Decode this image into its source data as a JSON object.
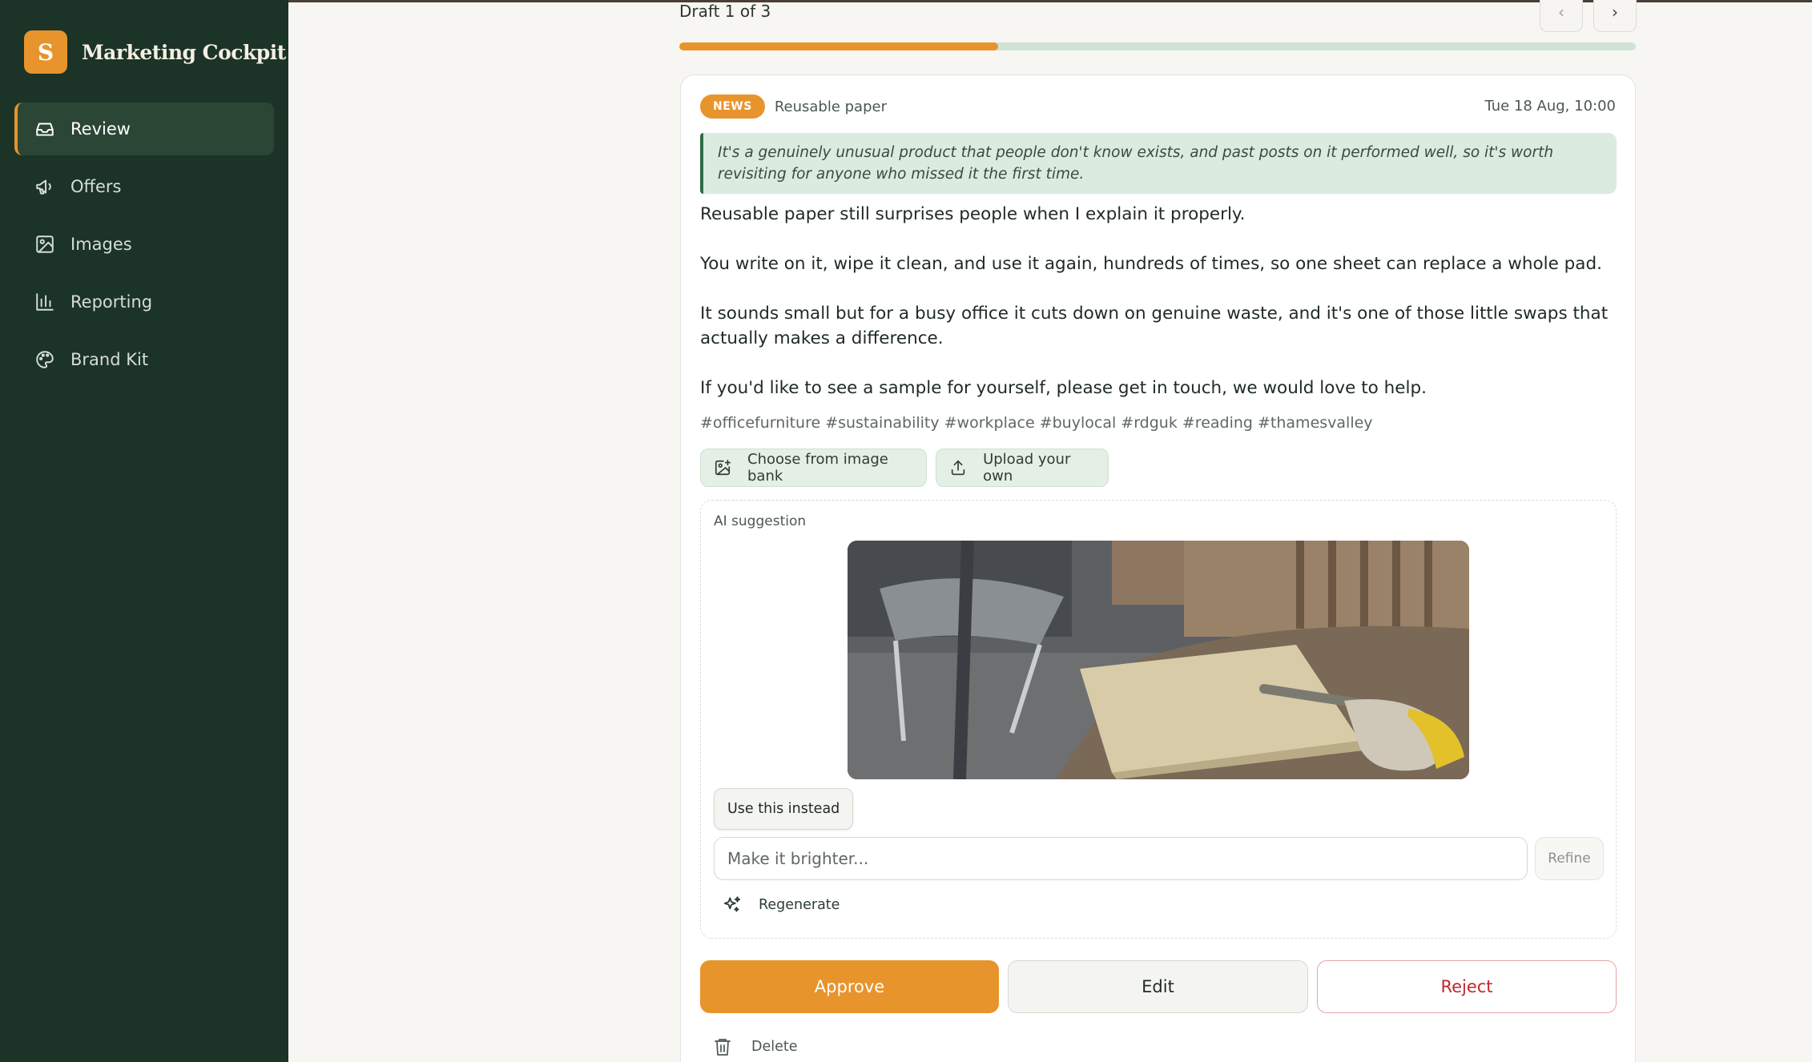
{
  "app": {
    "logo_letter": "S",
    "name": "Marketing Cockpit"
  },
  "sidebar": {
    "items": [
      {
        "label": "Review",
        "icon": "inbox-icon",
        "active": true
      },
      {
        "label": "Offers",
        "icon": "megaphone-icon",
        "active": false
      },
      {
        "label": "Images",
        "icon": "image-icon",
        "active": false
      },
      {
        "label": "Reporting",
        "icon": "bar-chart-icon",
        "active": false
      },
      {
        "label": "Brand Kit",
        "icon": "palette-icon",
        "active": false
      }
    ]
  },
  "header": {
    "draft_label": "Draft 1 of 3",
    "prev_icon": "chevron-left-icon",
    "next_icon": "chevron-right-icon",
    "progress_fraction": 0.333
  },
  "post": {
    "badge": "NEWS",
    "topic": "Reusable paper",
    "date": "Tue 18 Aug, 10:00",
    "rationale": "It's a genuinely unusual product that people don't know exists, and past posts on it performed well, so it's worth revisiting for anyone who missed it the first time.",
    "paragraphs": [
      "Reusable paper still surprises people when I explain it properly.",
      "You write on it, wipe it clean, and use it again, hundreds of times, so one sheet can replace a whole pad.",
      "It sounds small but for a busy office it cuts down on genuine waste, and it's one of those little swaps that actually makes a difference.",
      "If you'd like to see a sample for yourself, please get in touch, we would love to help."
    ],
    "hashtags": "#officefurniture #sustainability #workplace #buylocal #rdguk #reading #thamesvalley"
  },
  "image_actions": {
    "bank_label": "Choose from image bank",
    "upload_label": "Upload your own"
  },
  "ai": {
    "label": "AI suggestion",
    "use_label": "Use this instead",
    "refine_placeholder": "Make it brighter...",
    "refine_value": "",
    "refine_label": "Refine",
    "regenerate_label": "Regenerate"
  },
  "actions": {
    "approve": "Approve",
    "edit": "Edit",
    "reject": "Reject",
    "delete": "Delete"
  },
  "colors": {
    "sidebar_bg": "#1c3327",
    "accent": "#e8942c",
    "reject": "#c0262d",
    "rationale_bg": "#dcebe0"
  }
}
